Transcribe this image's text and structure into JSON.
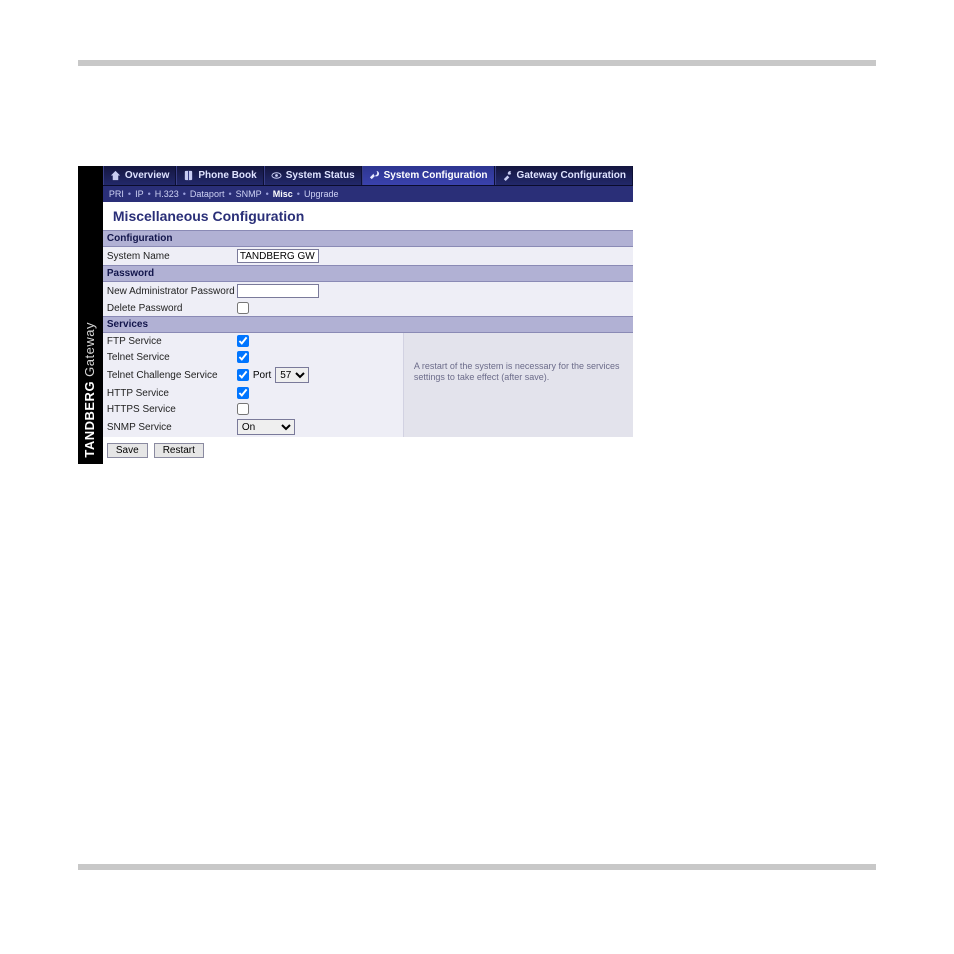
{
  "brand": {
    "name": "TANDBERG",
    "product": "Gateway"
  },
  "tabs": [
    {
      "label": "Overview"
    },
    {
      "label": "Phone Book"
    },
    {
      "label": "System Status"
    },
    {
      "label": "System Configuration"
    },
    {
      "label": "Gateway Configuration"
    }
  ],
  "subnav": {
    "items": [
      "PRI",
      "IP",
      "H.323",
      "Dataport",
      "SNMP",
      "Misc",
      "Upgrade"
    ],
    "active": "Misc"
  },
  "page": {
    "title": "Miscellaneous Configuration"
  },
  "sections": {
    "configuration": {
      "header": "Configuration",
      "system_name_label": "System Name",
      "system_name_value": "TANDBERG GW"
    },
    "password": {
      "header": "Password",
      "new_admin_label": "New Administrator Password",
      "new_admin_value": "",
      "delete_label": "Delete Password",
      "delete_checked": false
    },
    "services": {
      "header": "Services",
      "ftp_label": "FTP Service",
      "ftp_checked": true,
      "telnet_label": "Telnet Service",
      "telnet_checked": true,
      "telnet_challenge_label": "Telnet Challenge Service",
      "telnet_challenge_checked": true,
      "port_label": "Port",
      "port_value": "57",
      "http_label": "HTTP Service",
      "http_checked": true,
      "https_label": "HTTPS Service",
      "https_checked": false,
      "snmp_label": "SNMP Service",
      "snmp_value": "On",
      "note": "A restart of the system is necessary for the services settings to take effect (after save)."
    }
  },
  "buttons": {
    "save": "Save",
    "restart": "Restart"
  }
}
